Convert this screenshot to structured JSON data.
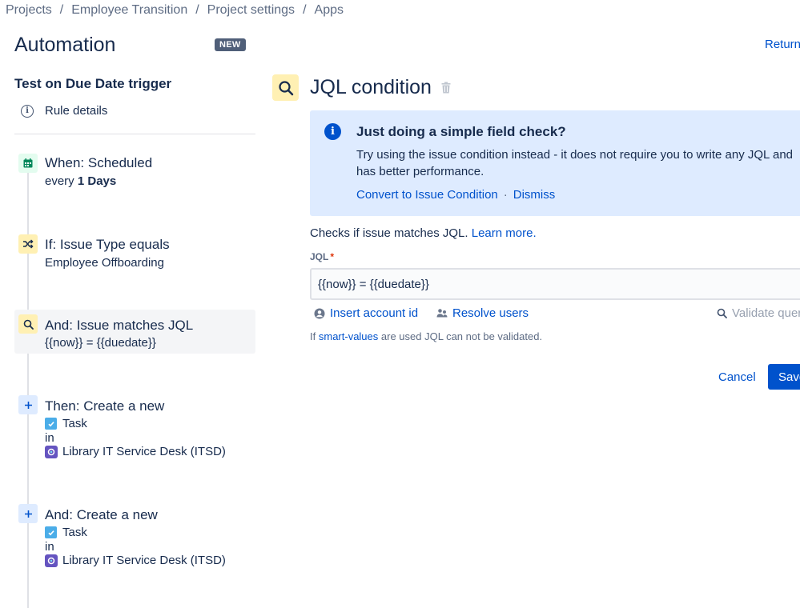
{
  "breadcrumb": {
    "items": [
      "Projects",
      "Employee Transition",
      "Project settings",
      "Apps"
    ],
    "separator": "/"
  },
  "header": {
    "title": "Automation",
    "badge": "NEW",
    "return_link": "Return to list"
  },
  "sidebar": {
    "rule_name": "Test on Due Date trigger",
    "rule_details": "Rule details",
    "steps": [
      {
        "icon": "calendar-icon",
        "title": "When: Scheduled",
        "subtitle_prefix": "every ",
        "subtitle_bold": "1 Days"
      },
      {
        "icon": "shuffle-icon",
        "title": "If: Issue Type equals",
        "subtitle": "Employee Offboarding"
      },
      {
        "icon": "search-icon",
        "title": "And: Issue matches JQL",
        "subtitle": "{{now}} = {{duedate}}"
      },
      {
        "icon": "plus-icon",
        "title": "Then: Create a new",
        "issue_type": "Task",
        "in": "in",
        "project": "Library IT Service Desk (ITSD)"
      },
      {
        "icon": "plus-icon",
        "title": "And: Create a new",
        "issue_type": "Task",
        "in": "in",
        "project": "Library IT Service Desk (ITSD)"
      }
    ]
  },
  "main": {
    "title": "JQL condition",
    "info_panel": {
      "title": "Just doing a simple field check?",
      "line1": "Try using the issue condition instead - it does not require you to write any JQL and",
      "line2": "has better performance.",
      "convert_link": "Convert to Issue Condition",
      "separator": "·",
      "dismiss_link": "Dismiss"
    },
    "description": "Checks if issue matches JQL.",
    "learn_more": "Learn more.",
    "jql_label": "JQL",
    "required_marker": "*",
    "jql_value": "{{now}} = {{duedate}}",
    "insert_account": "Insert account id",
    "resolve_users": "Resolve users",
    "validate_query": "Validate query",
    "hint_prefix": "If",
    "hint_link": "smart-values",
    "hint_suffix": "are used JQL can not be validated.",
    "cancel_button": "Cancel",
    "save_button": "Save"
  },
  "colors": {
    "primary": "#0052cc",
    "info_bg": "#deebff",
    "condition_icon_bg": "#fff0b3",
    "trigger_icon_bg": "#e3fcef",
    "action_icon_bg": "#deebff",
    "text": "#172b4d"
  }
}
